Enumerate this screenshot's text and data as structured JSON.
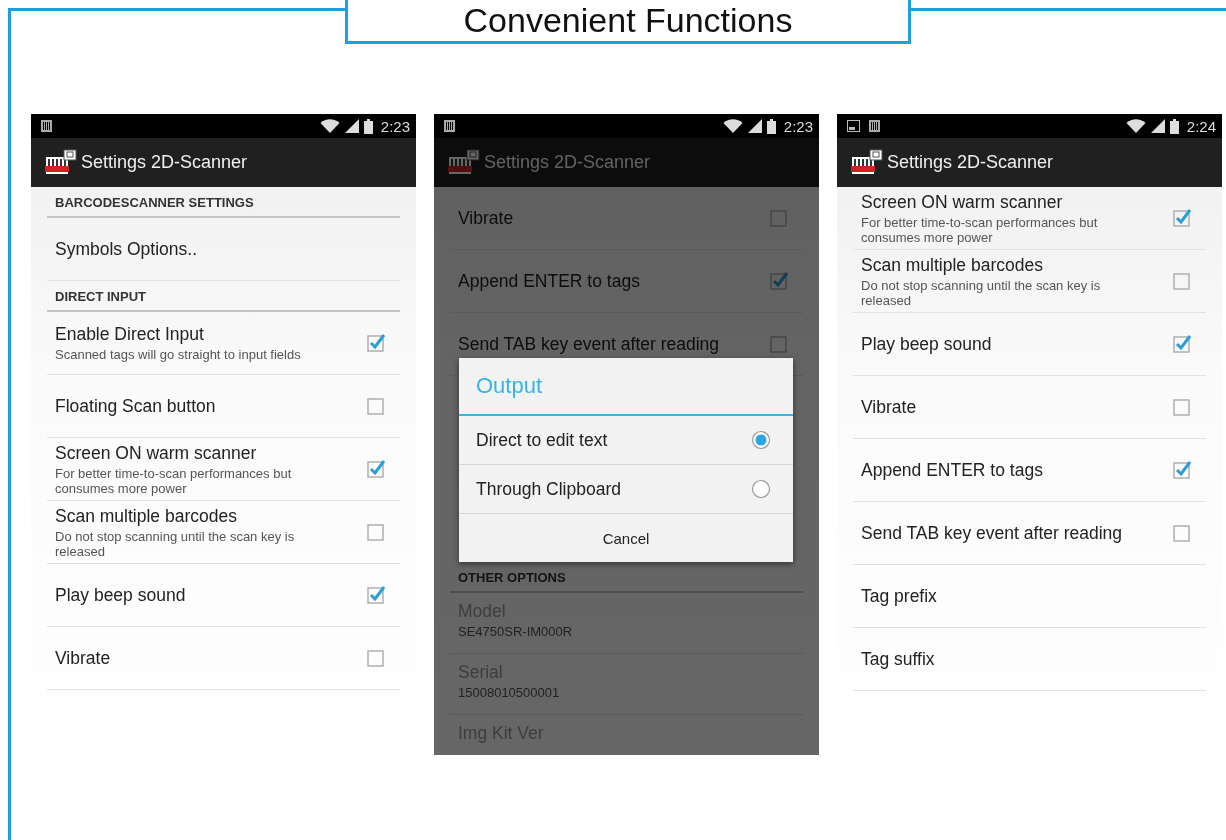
{
  "title": "Convenient Functions",
  "phones": [
    {
      "status_bar": {
        "notifications": [
          {
            "kind": "scanner"
          }
        ],
        "time": "2:23"
      },
      "app_bar": {
        "title": "Settings 2D-Scanner"
      },
      "dimmed": false,
      "items": [
        {
          "kind": "header",
          "label": "BARCODESCANNER SETTINGS"
        },
        {
          "kind": "link",
          "title": "Symbols Options.."
        },
        {
          "kind": "header",
          "label": "DIRECT INPUT"
        },
        {
          "kind": "check",
          "title": "Enable Direct Input",
          "summary": "Scanned tags will go straight to input fields",
          "checked": true
        },
        {
          "kind": "check",
          "title": "Floating Scan button",
          "checked": false
        },
        {
          "kind": "check",
          "title": "Screen ON warm scanner",
          "summary": "For better time-to-scan performances but consumes more power",
          "checked": true
        },
        {
          "kind": "check",
          "title": "Scan multiple barcodes",
          "summary": "Do not stop scanning until the scan key is released",
          "checked": false
        },
        {
          "kind": "check",
          "title": "Play beep sound",
          "checked": true
        },
        {
          "kind": "check",
          "title": "Vibrate",
          "checked": false
        }
      ]
    },
    {
      "status_bar": {
        "notifications": [
          {
            "kind": "scanner"
          }
        ],
        "time": "2:23"
      },
      "app_bar": {
        "title": "Settings 2D-Scanner"
      },
      "dimmed": true,
      "items": [
        {
          "kind": "check",
          "title": "Vibrate",
          "checked": false
        },
        {
          "kind": "check",
          "title": "Append ENTER to tags",
          "checked": true
        },
        {
          "kind": "check",
          "title": "Send TAB key event after reading",
          "checked": false
        },
        {
          "kind": "header",
          "label": "OTHER OPTIONS"
        },
        {
          "kind": "info",
          "title": "Model",
          "value": "SE4750SR-IM000R"
        },
        {
          "kind": "info",
          "title": "Serial",
          "value": "15008010500001"
        },
        {
          "kind": "info",
          "title": "Img Kit Ver"
        }
      ],
      "dialog": {
        "title": "Output",
        "options": [
          {
            "label": "Direct to edit text",
            "selected": true
          },
          {
            "label": "Through Clipboard",
            "selected": false
          }
        ],
        "button": "Cancel"
      }
    },
    {
      "status_bar": {
        "notifications": [
          {
            "kind": "picture"
          },
          {
            "kind": "scanner"
          }
        ],
        "time": "2:24"
      },
      "app_bar": {
        "title": "Settings 2D-Scanner"
      },
      "dimmed": false,
      "items": [
        {
          "kind": "check",
          "title": "Screen ON warm scanner",
          "summary": "For better time-to-scan performances but consumes more power",
          "checked": true
        },
        {
          "kind": "check",
          "title": "Scan multiple barcodes",
          "summary": "Do not stop scanning until the scan key is released",
          "checked": false
        },
        {
          "kind": "check",
          "title": "Play beep sound",
          "checked": true
        },
        {
          "kind": "check",
          "title": "Vibrate",
          "checked": false
        },
        {
          "kind": "check",
          "title": "Append ENTER to tags",
          "checked": true
        },
        {
          "kind": "check",
          "title": "Send TAB key event after reading",
          "checked": false
        },
        {
          "kind": "link",
          "title": "Tag prefix"
        },
        {
          "kind": "link",
          "title": "Tag suffix"
        }
      ]
    }
  ]
}
